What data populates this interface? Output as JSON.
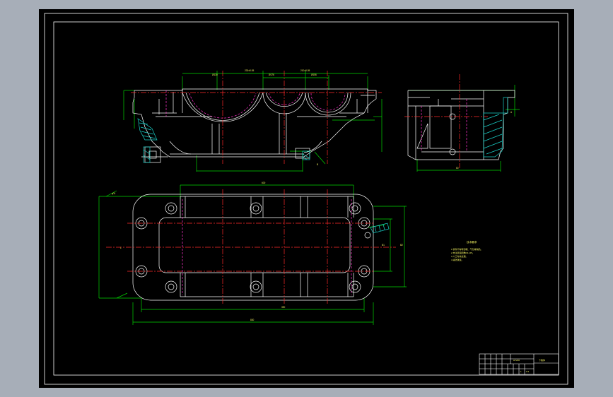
{
  "drawing": {
    "colors": {
      "background": "#a7aeb8",
      "sheet": "#000000",
      "outline": "#ffffff",
      "dimension": "#00d400",
      "centerline": "#ff2a2a",
      "hidden": "#ff33cc",
      "section_hatch": "#19d0c8",
      "text": "#f0f060"
    },
    "top_dims": [
      "230±0.05",
      "210±0.05",
      "Ø176",
      "Ø156",
      "Ø130"
    ],
    "plan_dims": [
      "φ11",
      "L",
      "B1",
      "B2",
      "830",
      "390",
      "600"
    ],
    "side_dims": [
      "A",
      "B",
      "60"
    ],
    "tech_requirements": {
      "title": "技术要求",
      "lines": [
        "1.铸件不得有砂眼、气孔等缺陷。",
        "2.未注铸造圆角R3~R5。",
        "3.人工时效处理。",
        "4.涂防锈漆。"
      ]
    },
    "title_block": {
      "name": "下箱体",
      "material": "HT200",
      "scale": "1:5",
      "sheet": "1"
    }
  }
}
